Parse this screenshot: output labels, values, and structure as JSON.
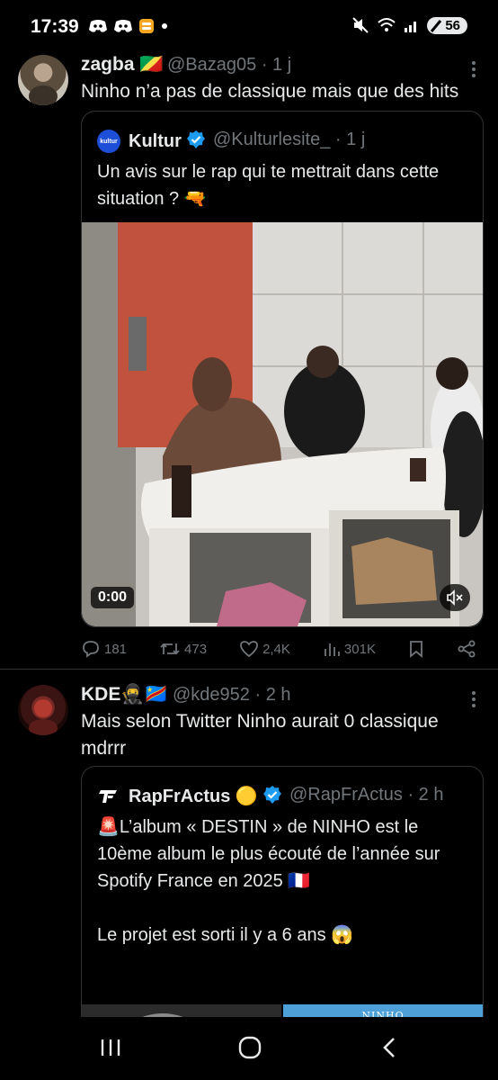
{
  "status_bar": {
    "time": "17:39",
    "battery": "56",
    "icons_left": [
      "discord-icon",
      "discord-icon",
      "burger-icon",
      "dot-icon"
    ],
    "icons_right": [
      "mute-icon",
      "wifi-icon",
      "signal-icon",
      "battery-icon"
    ]
  },
  "tweets": [
    {
      "name": "zagba",
      "flag": "🇨🇬",
      "handle": "@Bazag05 · 1 j",
      "text": "Ninho n’a pas de classique mais que des hits",
      "quote": {
        "avatar_text": "kultur",
        "name": "Kultur",
        "handle": "@Kulturlesite_ · 1 j",
        "text": "Un avis sur le rap qui te mettrait dans cette situation ? 🔫",
        "video_time": "0:00"
      },
      "actions": {
        "replies": "181",
        "reposts": "473",
        "likes": "2,4K",
        "views": "301K"
      }
    },
    {
      "name": "KDE🥷🇨🇩",
      "handle": "@kde952 · 2 h",
      "text": "Mais selon Twitter Ninho aurait 0 classique mdrrr",
      "quote": {
        "name": "RapFrActus 🟡",
        "handle": "@RapFrActus · 2 h",
        "text": "🚨L’album « DESTIN » de NINHO est le 10ème album le plus écouté de l’année sur Spotify France en 2025 🇫🇷\n\nLe projet est sorti il y a 6 ans 😱",
        "album_text": "NINHO"
      }
    }
  ],
  "colors": {
    "background": "#000000",
    "text": "#e7e9ea",
    "muted": "#71767b",
    "border": "#2f3336",
    "verified": "#1d9bf0"
  }
}
